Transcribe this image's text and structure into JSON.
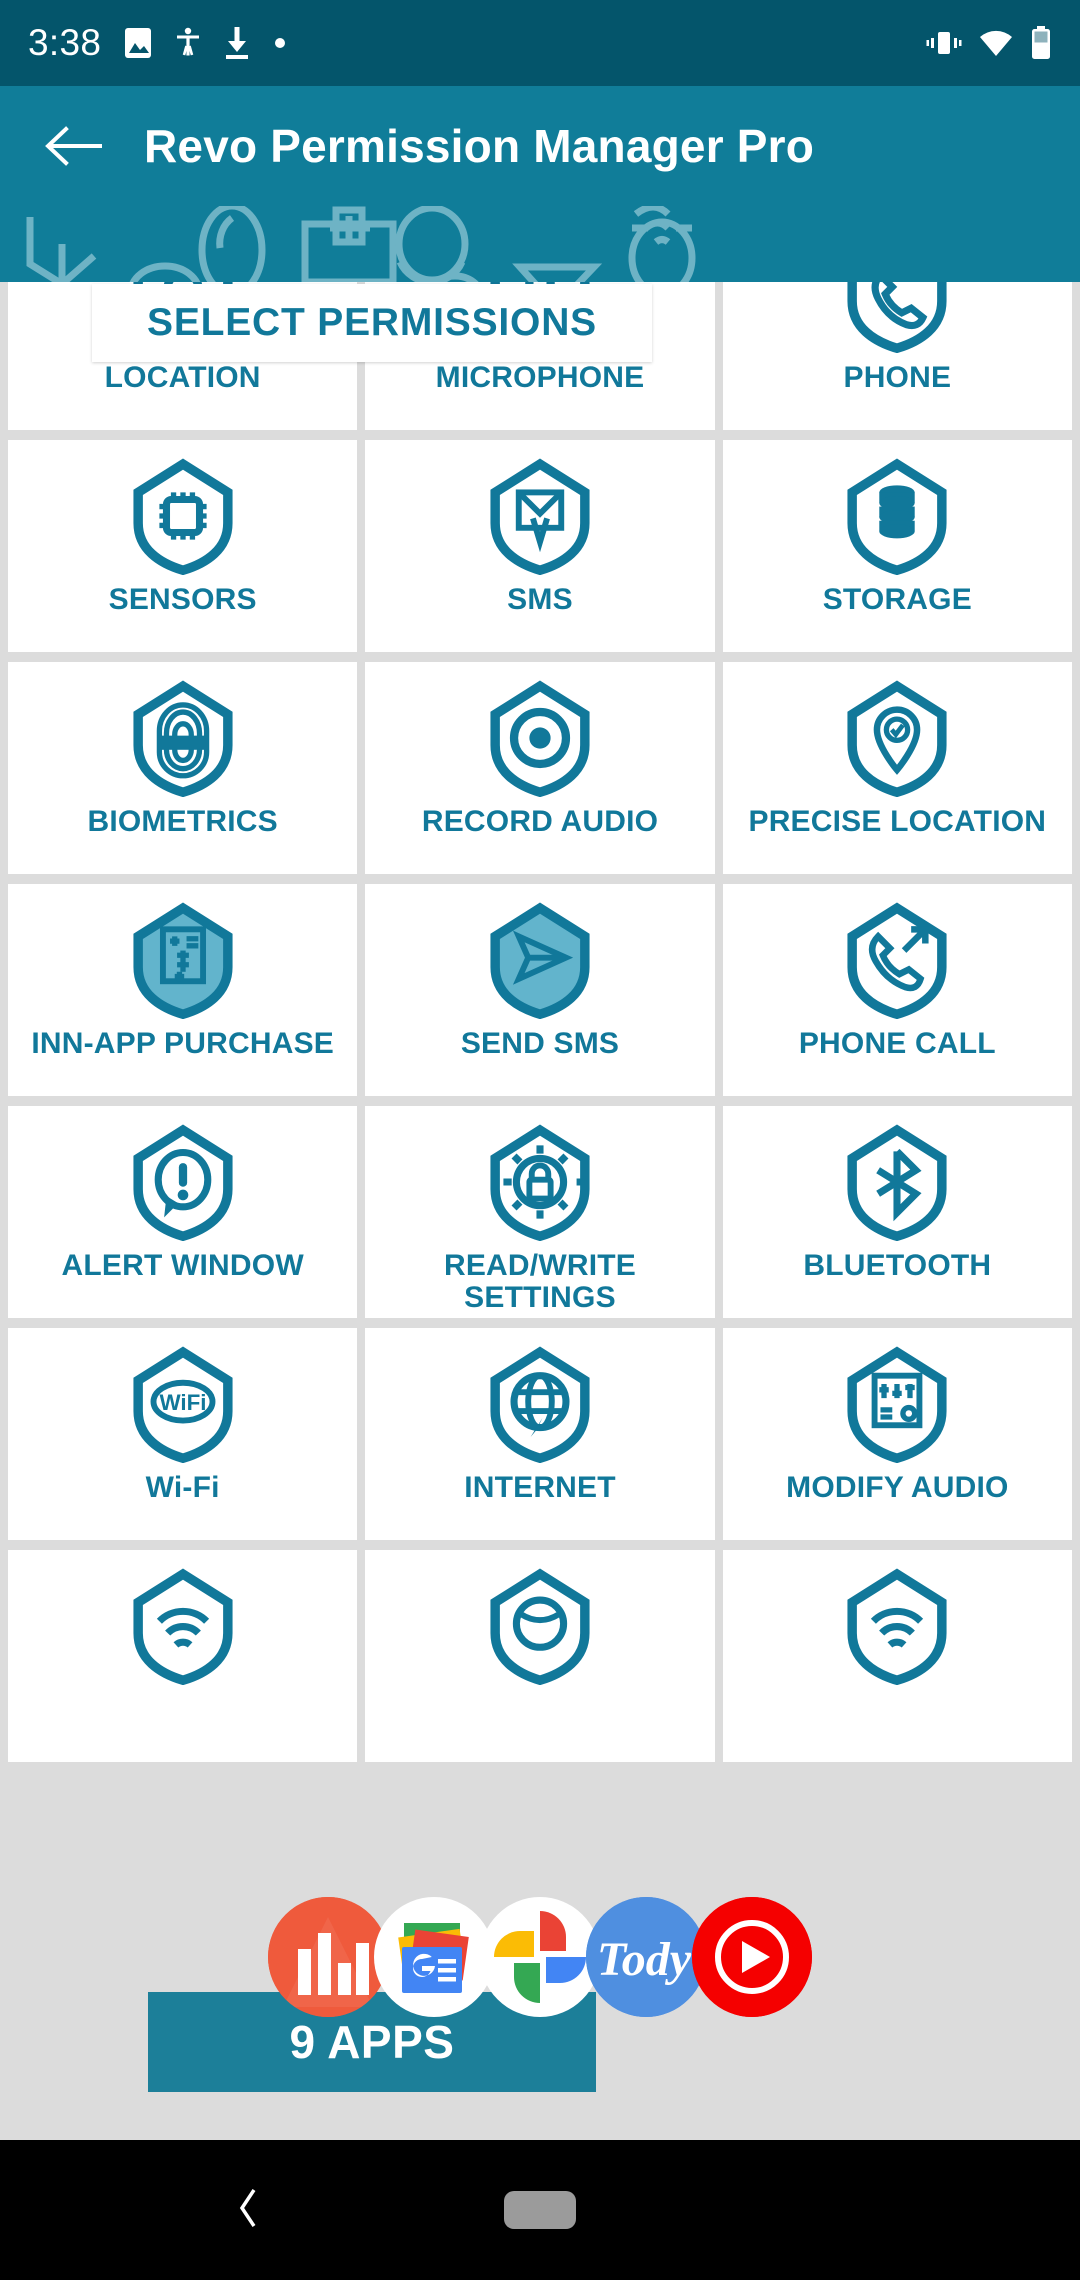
{
  "status_bar": {
    "time": "3:38",
    "left_icons": [
      "image-icon",
      "accessibility-icon",
      "download-icon",
      "dot-icon"
    ],
    "right_icons": [
      "vibrate-icon",
      "wifi-icon",
      "battery-icon"
    ],
    "background_color": "#04556b"
  },
  "app_bar": {
    "back_icon": "arrow-left-icon",
    "title": "Revo Permission Manager Pro",
    "background_color": "#107d99",
    "text_color": "#ffffff"
  },
  "select_card": {
    "label": "SELECT PERMISSIONS",
    "text_color": "#11789a",
    "background_color": "#ffffff"
  },
  "theme": {
    "accent": "#11789a",
    "page_background": "#dcdcdc",
    "card_background": "#ffffff",
    "banner_background": "#1c7f99"
  },
  "grid": {
    "columns": 3,
    "cells": [
      {
        "label": "LOCATION",
        "icon": "shield-location-icon",
        "shield_style": "outline"
      },
      {
        "label": "MICROPHONE",
        "icon": "shield-microphone-icon",
        "shield_style": "outline"
      },
      {
        "label": "PHONE",
        "icon": "shield-phone-icon",
        "shield_style": "outline"
      },
      {
        "label": "SENSORS",
        "icon": "shield-chip-icon",
        "shield_style": "outline"
      },
      {
        "label": "SMS",
        "icon": "shield-envelope-icon",
        "shield_style": "outline"
      },
      {
        "label": "STORAGE",
        "icon": "shield-database-icon",
        "shield_style": "outline"
      },
      {
        "label": "BIOMETRICS",
        "icon": "shield-fingerprint-icon",
        "shield_style": "outline"
      },
      {
        "label": "RECORD AUDIO",
        "icon": "shield-record-icon",
        "shield_style": "outline"
      },
      {
        "label": "PRECISE LOCATION",
        "icon": "shield-pin-check-icon",
        "shield_style": "outline"
      },
      {
        "label": "INN-APP PURCHASE",
        "icon": "shield-receipt-icon",
        "shield_style": "filled"
      },
      {
        "label": "SEND SMS",
        "icon": "shield-send-icon",
        "shield_style": "filled"
      },
      {
        "label": "PHONE CALL",
        "icon": "shield-call-out-icon",
        "shield_style": "outline"
      },
      {
        "label": "ALERT WINDOW",
        "icon": "shield-alert-bubble-icon",
        "shield_style": "outline"
      },
      {
        "label": "READ/WRITE SETTINGS",
        "icon": "shield-gear-lock-icon",
        "shield_style": "outline"
      },
      {
        "label": "BLUETOOTH",
        "icon": "shield-bluetooth-icon",
        "shield_style": "outline"
      },
      {
        "label": "Wi-Fi",
        "icon": "shield-wifi-icon",
        "shield_style": "outline"
      },
      {
        "label": "INTERNET",
        "icon": "shield-globe-icon",
        "shield_style": "outline"
      },
      {
        "label": "MODIFY AUDIO",
        "icon": "shield-equalizer-icon",
        "shield_style": "outline"
      },
      {
        "label": "",
        "icon": "shield-wifi-icon",
        "shield_style": "outline"
      },
      {
        "label": "",
        "icon": "shield-globe-icon",
        "shield_style": "outline"
      },
      {
        "label": "",
        "icon": "shield-wifi-icon",
        "shield_style": "outline"
      }
    ]
  },
  "app_chips": [
    {
      "name": "analytics-app",
      "icon": "bar-chart-icon",
      "color": "#ef5a3c"
    },
    {
      "name": "google-news-app",
      "icon": "google-news-icon",
      "color": "#ffffff"
    },
    {
      "name": "google-photos-app",
      "icon": "google-photos-icon",
      "color": "#ffffff"
    },
    {
      "name": "tody-app",
      "icon": "tody-icon",
      "color": "#4f8fe0"
    },
    {
      "name": "youtube-music-app",
      "icon": "play-circle-icon",
      "color": "#f50000"
    }
  ],
  "apps_banner": {
    "label": "9 APPS",
    "background_color": "#1c7f99",
    "text_color": "#ffffff"
  },
  "nav_bar": {
    "back_icon": "chevron-left-icon",
    "home_icon": "home-pill-icon",
    "background_color": "#000000"
  }
}
